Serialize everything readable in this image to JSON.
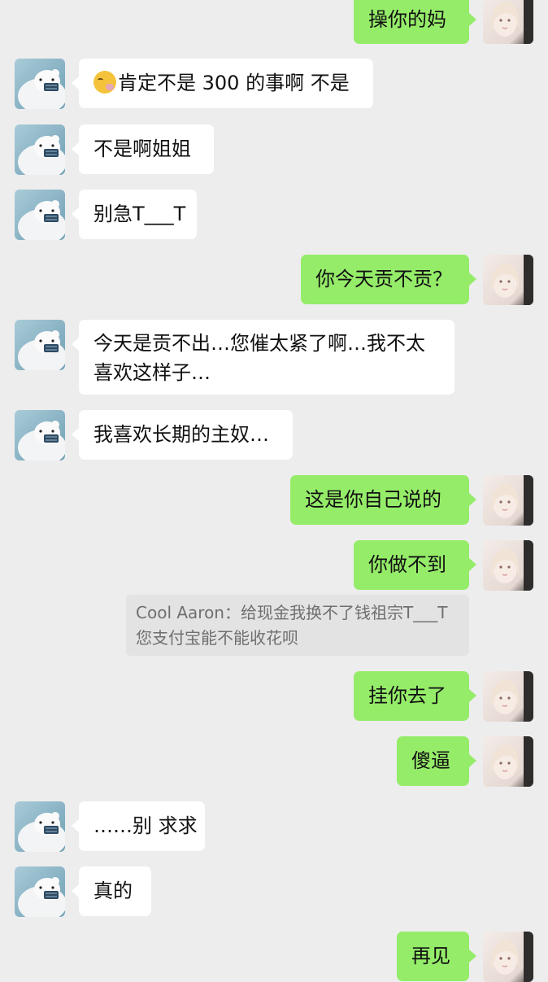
{
  "conversation": {
    "messages": [
      {
        "side": "right",
        "text": "操你的妈"
      },
      {
        "side": "left",
        "text": "肯定不是 300 的事啊 不是",
        "emoji": "face-with-hand-over-mouth"
      },
      {
        "side": "left",
        "text": "不是啊姐姐"
      },
      {
        "side": "left",
        "text": "别急T___T"
      },
      {
        "side": "right",
        "text": "你今天贡不贡？"
      },
      {
        "side": "left",
        "lines": [
          "今天是贡不出…您催太紧了啊…我不太",
          "喜欢这样子…"
        ]
      },
      {
        "side": "left",
        "text": "我喜欢长期的主奴…"
      },
      {
        "side": "right",
        "text": "这是你自己说的"
      },
      {
        "side": "right",
        "text": "你做不到"
      },
      {
        "side": "right",
        "text": "挂你去了"
      },
      {
        "side": "right",
        "text": "傻逼"
      },
      {
        "side": "left",
        "text": "……别 求求"
      },
      {
        "side": "left",
        "text": "真的"
      },
      {
        "side": "right",
        "text": "再见"
      }
    ],
    "quote": {
      "lines": [
        "Cool Aaron：给现金我换不了钱祖宗T___T",
        "您支付宝能不能收花呗"
      ]
    }
  },
  "colors": {
    "background": "#ededed",
    "incoming_bubble": "#ffffff",
    "outgoing_bubble": "#95ec69",
    "quote_background": "#e3e3e3",
    "quote_text": "#6f6f6f"
  }
}
